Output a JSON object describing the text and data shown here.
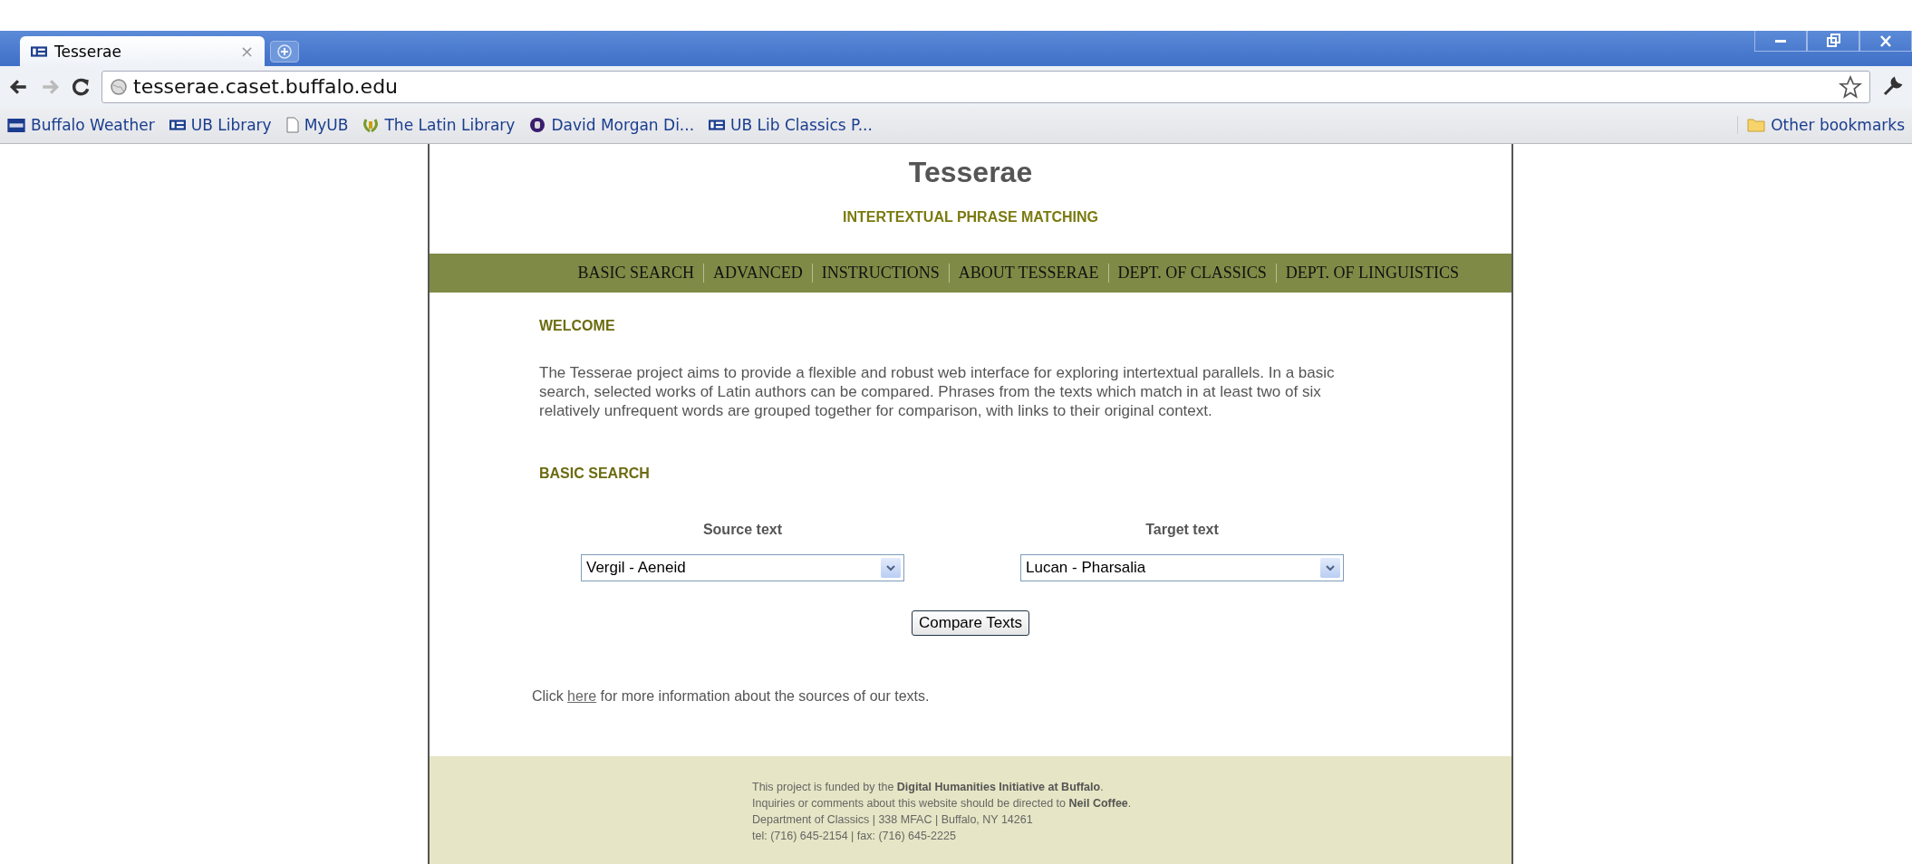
{
  "browser": {
    "tab": {
      "title": "Tesserae",
      "close": "×"
    },
    "url": "tesserae.caset.buffalo.edu",
    "bookmarks": [
      {
        "label": "Buffalo Weather",
        "kind": "twc"
      },
      {
        "label": "UB Library",
        "kind": "ub"
      },
      {
        "label": "MyUB",
        "kind": "page"
      },
      {
        "label": "The Latin Library",
        "kind": "wreath"
      },
      {
        "label": "David Morgan Di...",
        "kind": "seal"
      },
      {
        "label": "UB Lib Classics P...",
        "kind": "ub"
      }
    ],
    "other_bookmarks": "Other bookmarks"
  },
  "site": {
    "title": "Tesserae",
    "subtitle": "INTERTEXTUAL PHRASE MATCHING",
    "nav": [
      "BASIC SEARCH",
      "ADVANCED",
      "INSTRUCTIONS",
      "ABOUT TESSERAE",
      "DEPT. OF CLASSICS",
      "DEPT. OF LINGUISTICS"
    ],
    "welcome_heading": "WELCOME",
    "welcome_text": "The Tesserae project aims to provide a flexible and robust web interface for exploring intertextual parallels. In a basic search, selected works of Latin authors can be compared. Phrases from the texts which match in at least two of six relatively unfrequent words are grouped together for comparison, with links to their original context.",
    "search_heading": "BASIC SEARCH",
    "source": {
      "label": "Source text",
      "value": "Vergil - Aeneid"
    },
    "target": {
      "label": "Target text",
      "value": "Lucan - Pharsalia"
    },
    "compare_button": "Compare Texts",
    "info_line": {
      "before": "Click",
      "link": "here",
      "after": "for more information about the sources of our texts."
    },
    "footer": [
      "This project is funded by the **Digital Humanities Initiative at Buffalo**.",
      "Inquiries or comments about this website should be directed to **Neil Coffee**.",
      "Department of Classics | 338 MFAC | Buffalo, NY 14261",
      "tel: (716) 645-2154 | fax: (716) 645-2225"
    ]
  }
}
